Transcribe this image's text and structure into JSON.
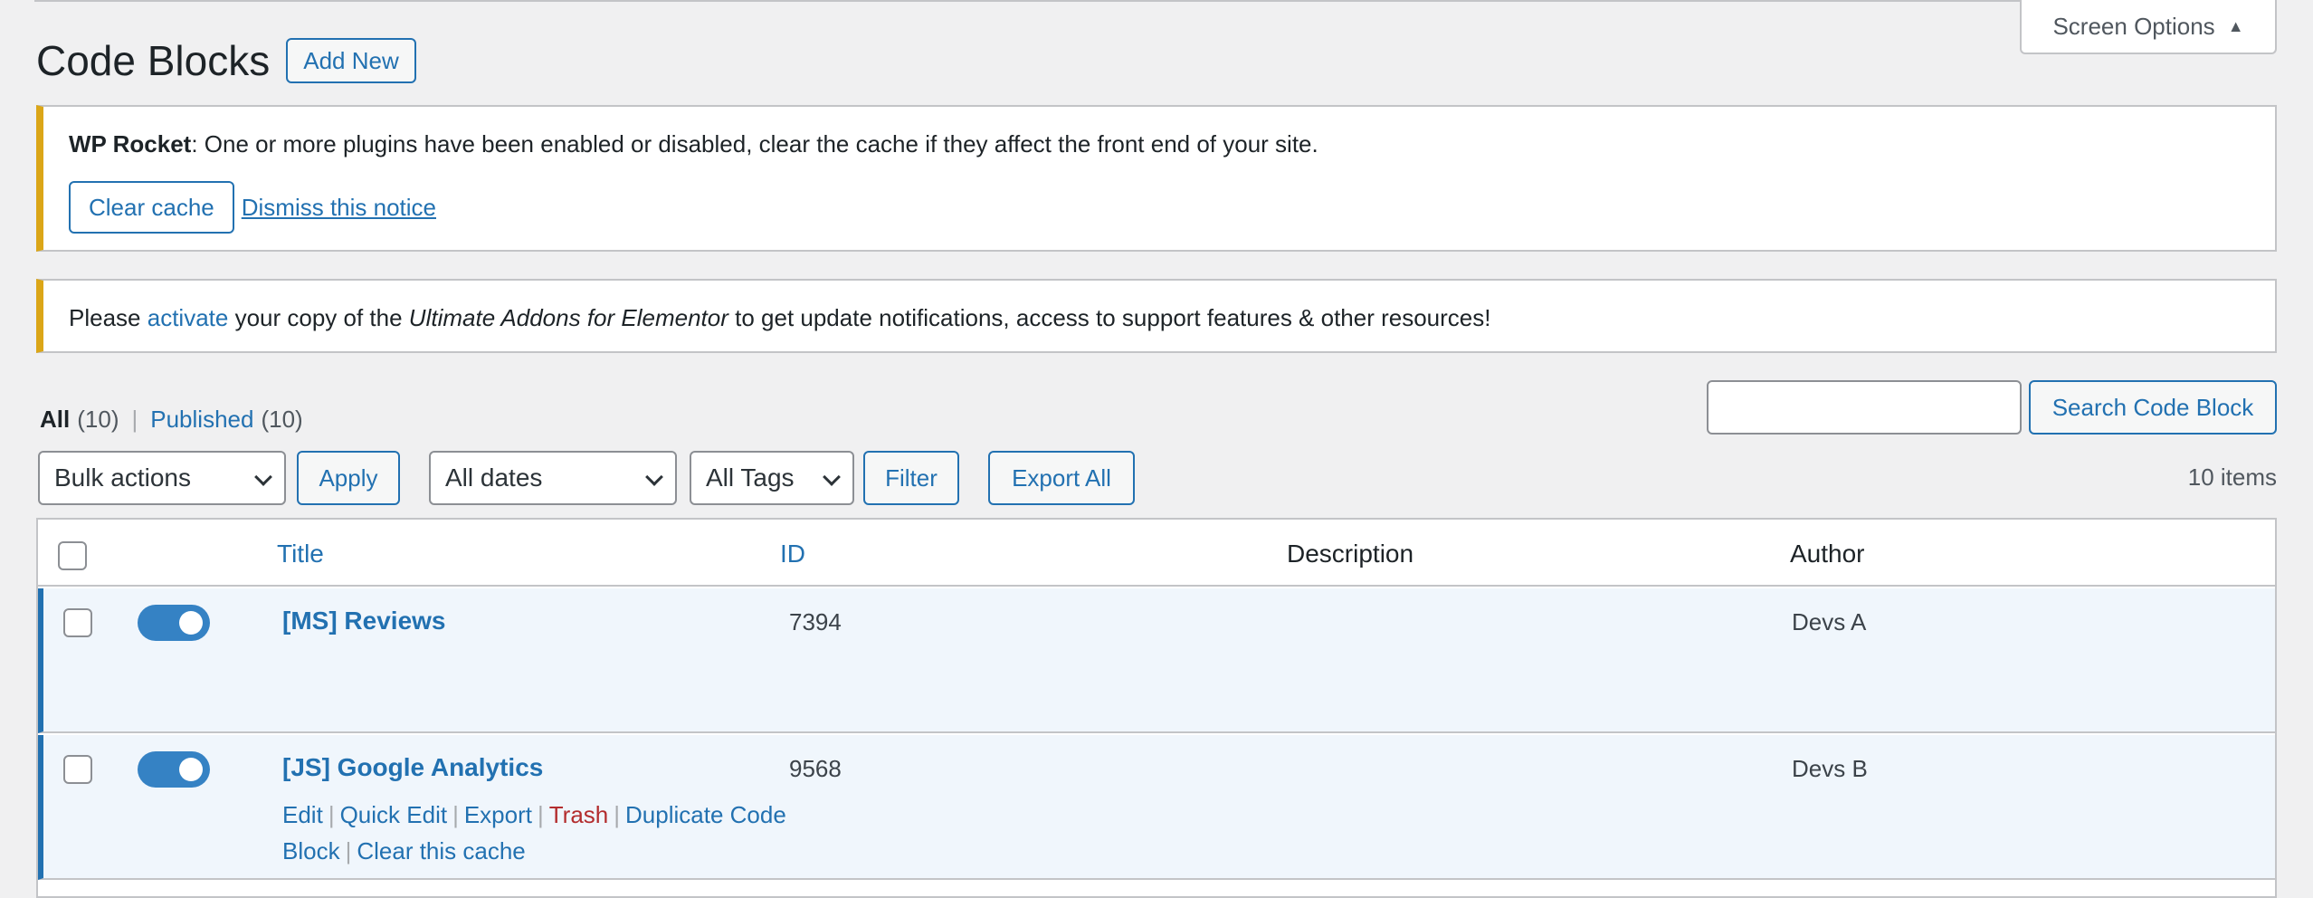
{
  "header": {
    "title": "Code Blocks",
    "add_new": "Add New",
    "screen_options": "Screen Options"
  },
  "notices": {
    "wp_rocket": {
      "brand": "WP Rocket",
      "message": ": One or more plugins have been enabled or disabled, clear the cache if they affect the front end of your site.",
      "clear_cache": "Clear cache",
      "dismiss": "Dismiss this notice"
    },
    "uae": {
      "prefix": "Please ",
      "link": "activate",
      "middle": " your copy of the ",
      "product": "Ultimate Addons for Elementor",
      "suffix": " to get update notifications, access to support features & other resources!"
    }
  },
  "views": {
    "all_label": "All",
    "all_count": "(10)",
    "separator": "|",
    "published_label": "Published",
    "published_count": "(10)"
  },
  "search": {
    "value": "",
    "button": "Search Code Block"
  },
  "tablenav": {
    "bulk_actions": "Bulk actions",
    "apply": "Apply",
    "dates": "All dates",
    "tags": "All Tags",
    "filter": "Filter",
    "export_all": "Export All",
    "items": "10 items"
  },
  "table": {
    "columns": {
      "title": "Title",
      "id": "ID",
      "description": "Description",
      "author": "Author"
    },
    "rows": [
      {
        "title": "[MS] Reviews",
        "id": "7394",
        "description": "",
        "author": "Devs A",
        "active": true
      },
      {
        "title": "[JS] Google Analytics",
        "id": "9568",
        "description": "",
        "author": "Devs B",
        "active": true,
        "actions": {
          "edit": "Edit",
          "quick_edit": "Quick Edit",
          "export": "Export",
          "trash": "Trash",
          "duplicate": "Duplicate Code Block",
          "clear_cache": "Clear this cache"
        }
      }
    ]
  },
  "colors": {
    "accent": "#2271b1",
    "toggle_on": "#3582c4",
    "notice_warning": "#dba617",
    "trash": "#b32d2e",
    "row_highlight": "#f0f6fc"
  }
}
